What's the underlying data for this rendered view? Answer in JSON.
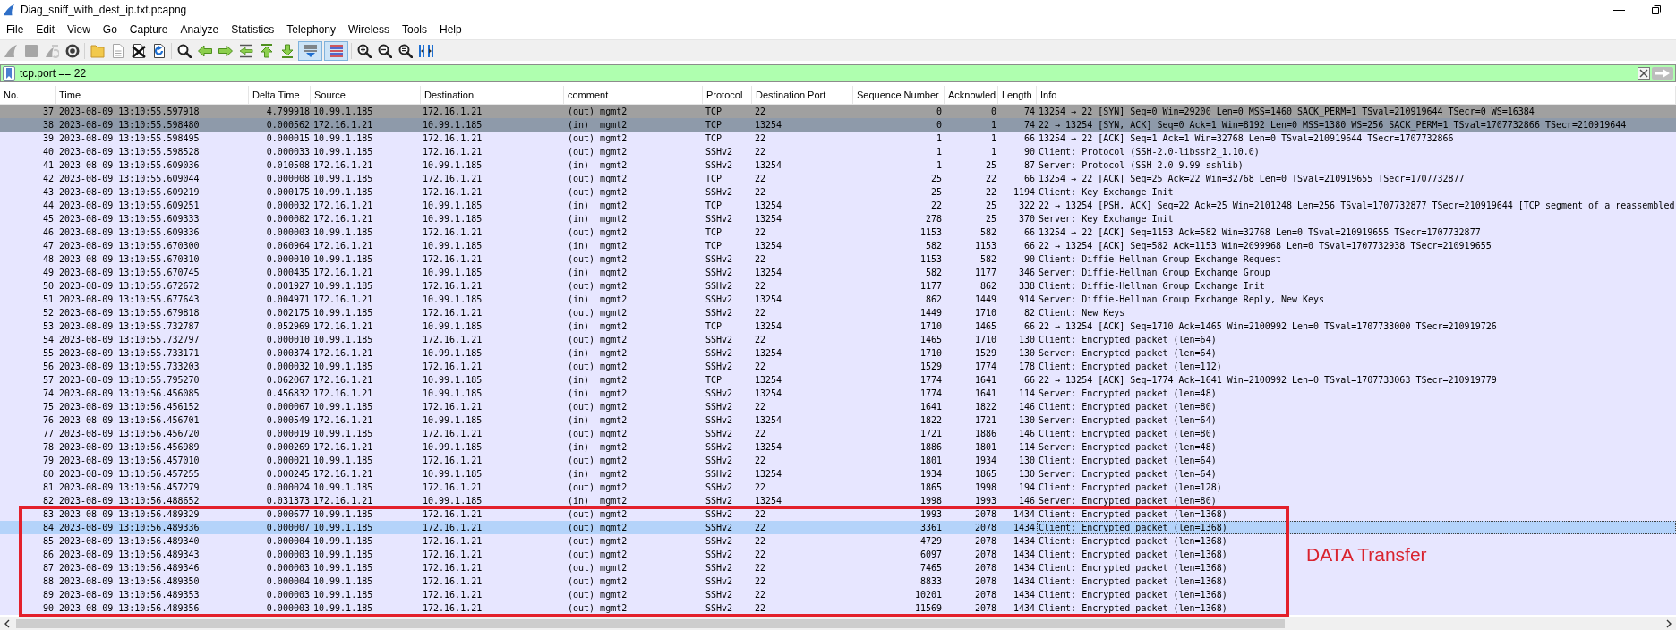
{
  "window": {
    "title": "Diag_sniff_with_dest_ip.txt.pcapng"
  },
  "menu": [
    "File",
    "Edit",
    "View",
    "Go",
    "Capture",
    "Analyze",
    "Statistics",
    "Telephony",
    "Wireless",
    "Tools",
    "Help"
  ],
  "toolbar": {
    "groups": [
      [
        {
          "kind": "start",
          "disabled": true,
          "pressed": false
        },
        {
          "kind": "stop",
          "disabled": true,
          "pressed": false
        },
        {
          "kind": "restart",
          "disabled": true,
          "pressed": false
        },
        {
          "kind": "options",
          "disabled": false,
          "pressed": false
        }
      ],
      [
        {
          "kind": "open",
          "disabled": false,
          "pressed": false
        },
        {
          "kind": "save",
          "disabled": true,
          "pressed": false
        },
        {
          "kind": "close",
          "disabled": false,
          "pressed": false
        },
        {
          "kind": "reload",
          "disabled": false,
          "pressed": false
        }
      ],
      [
        {
          "kind": "find",
          "disabled": false,
          "pressed": false
        },
        {
          "kind": "back",
          "disabled": false,
          "pressed": false
        },
        {
          "kind": "forward",
          "disabled": false,
          "pressed": false
        },
        {
          "kind": "goto",
          "disabled": false,
          "pressed": false
        },
        {
          "kind": "first",
          "disabled": false,
          "pressed": false
        },
        {
          "kind": "last",
          "disabled": false,
          "pressed": false
        },
        {
          "kind": "autoscroll",
          "disabled": false,
          "pressed": true
        },
        {
          "kind": "colorize",
          "disabled": false,
          "pressed": true
        }
      ],
      [
        {
          "kind": "zoomin",
          "disabled": false,
          "pressed": false
        },
        {
          "kind": "zoomout",
          "disabled": false,
          "pressed": false
        },
        {
          "kind": "zoomreset",
          "disabled": false,
          "pressed": false
        },
        {
          "kind": "resize",
          "disabled": false,
          "pressed": false
        }
      ]
    ]
  },
  "filter": {
    "value": "tcp.port == 22"
  },
  "packet_list": {
    "columns": [
      "No.",
      "Time",
      "Delta Time",
      "Source",
      "Destination",
      "comment",
      "Protocol",
      "Destination Port",
      "Sequence Number",
      "Acknowled",
      "Length",
      "Info"
    ],
    "rows": [
      {
        "cells": [
          "37",
          "2023-08-09 13:10:55.597918",
          "4.799918",
          "10.99.1.185",
          "172.16.1.21",
          "(out) mgmt2",
          "TCP",
          "22",
          "0",
          "0",
          "74",
          "13254 → 22 [SYN] Seq=0 Win=29200 Len=0 MSS=1460 SACK_PERM=1 TSval=210919644 TSecr=0 WS=16384"
        ],
        "color": "#a0a0a0",
        "selected": false
      },
      {
        "cells": [
          "38",
          "2023-08-09 13:10:55.598480",
          "0.000562",
          "172.16.1.21",
          "10.99.1.185",
          "(in)  mgmt2",
          "TCP",
          "13254",
          "0",
          "1",
          "74",
          "22 → 13254 [SYN, ACK] Seq=0 Ack=1 Win=8192 Len=0 MSS=1380 WS=256 SACK_PERM=1 TSval=1707732866 TSecr=210919644"
        ],
        "color": "#8e9aaa",
        "selected": false
      },
      {
        "cells": [
          "39",
          "2023-08-09 13:10:55.598495",
          "0.000015",
          "10.99.1.185",
          "172.16.1.21",
          "(out) mgmt2",
          "TCP",
          "22",
          "1",
          "1",
          "66",
          "13254 → 22 [ACK] Seq=1 Ack=1 Win=32768 Len=0 TSval=210919644 TSecr=1707732866"
        ],
        "color": "#e7e6ff",
        "selected": false
      },
      {
        "cells": [
          "40",
          "2023-08-09 13:10:55.598528",
          "0.000033",
          "10.99.1.185",
          "172.16.1.21",
          "(out) mgmt2",
          "SSHv2",
          "22",
          "1",
          "1",
          "90",
          "Client: Protocol (SSH-2.0-libssh2_1.10.0)"
        ],
        "color": "#e7e6ff",
        "selected": false
      },
      {
        "cells": [
          "41",
          "2023-08-09 13:10:55.609036",
          "0.010508",
          "172.16.1.21",
          "10.99.1.185",
          "(in)  mgmt2",
          "SSHv2",
          "13254",
          "1",
          "25",
          "87",
          "Server: Protocol (SSH-2.0-9.99 sshlib)"
        ],
        "color": "#e7e6ff",
        "selected": false
      },
      {
        "cells": [
          "42",
          "2023-08-09 13:10:55.609044",
          "0.000008",
          "10.99.1.185",
          "172.16.1.21",
          "(out) mgmt2",
          "TCP",
          "22",
          "25",
          "22",
          "66",
          "13254 → 22 [ACK] Seq=25 Ack=22 Win=32768 Len=0 TSval=210919655 TSecr=1707732877"
        ],
        "color": "#e7e6ff",
        "selected": false
      },
      {
        "cells": [
          "43",
          "2023-08-09 13:10:55.609219",
          "0.000175",
          "10.99.1.185",
          "172.16.1.21",
          "(out) mgmt2",
          "SSHv2",
          "22",
          "25",
          "22",
          "1194",
          "Client: Key Exchange Init"
        ],
        "color": "#e7e6ff",
        "selected": false
      },
      {
        "cells": [
          "44",
          "2023-08-09 13:10:55.609251",
          "0.000032",
          "172.16.1.21",
          "10.99.1.185",
          "(in)  mgmt2",
          "TCP",
          "13254",
          "22",
          "25",
          "322",
          "22 → 13254 [PSH, ACK] Seq=22 Ack=25 Win=2101248 Len=256 TSval=1707732877 TSecr=210919644 [TCP segment of a reassembled"
        ],
        "color": "#e7e6ff",
        "selected": false
      },
      {
        "cells": [
          "45",
          "2023-08-09 13:10:55.609333",
          "0.000082",
          "172.16.1.21",
          "10.99.1.185",
          "(in)  mgmt2",
          "SSHv2",
          "13254",
          "278",
          "25",
          "370",
          "Server: Key Exchange Init"
        ],
        "color": "#e7e6ff",
        "selected": false
      },
      {
        "cells": [
          "46",
          "2023-08-09 13:10:55.609336",
          "0.000003",
          "10.99.1.185",
          "172.16.1.21",
          "(out) mgmt2",
          "TCP",
          "22",
          "1153",
          "582",
          "66",
          "13254 → 22 [ACK] Seq=1153 Ack=582 Win=32768 Len=0 TSval=210919655 TSecr=1707732877"
        ],
        "color": "#e7e6ff",
        "selected": false
      },
      {
        "cells": [
          "47",
          "2023-08-09 13:10:55.670300",
          "0.060964",
          "172.16.1.21",
          "10.99.1.185",
          "(in)  mgmt2",
          "TCP",
          "13254",
          "582",
          "1153",
          "66",
          "22 → 13254 [ACK] Seq=582 Ack=1153 Win=2099968 Len=0 TSval=1707732938 TSecr=210919655"
        ],
        "color": "#e7e6ff",
        "selected": false
      },
      {
        "cells": [
          "48",
          "2023-08-09 13:10:55.670310",
          "0.000010",
          "10.99.1.185",
          "172.16.1.21",
          "(out) mgmt2",
          "SSHv2",
          "22",
          "1153",
          "582",
          "90",
          "Client: Diffie-Hellman Group Exchange Request"
        ],
        "color": "#e7e6ff",
        "selected": false
      },
      {
        "cells": [
          "49",
          "2023-08-09 13:10:55.670745",
          "0.000435",
          "172.16.1.21",
          "10.99.1.185",
          "(in)  mgmt2",
          "SSHv2",
          "13254",
          "582",
          "1177",
          "346",
          "Server: Diffie-Hellman Group Exchange Group"
        ],
        "color": "#e7e6ff",
        "selected": false
      },
      {
        "cells": [
          "50",
          "2023-08-09 13:10:55.672672",
          "0.001927",
          "10.99.1.185",
          "172.16.1.21",
          "(out) mgmt2",
          "SSHv2",
          "22",
          "1177",
          "862",
          "338",
          "Client: Diffie-Hellman Group Exchange Init"
        ],
        "color": "#e7e6ff",
        "selected": false
      },
      {
        "cells": [
          "51",
          "2023-08-09 13:10:55.677643",
          "0.004971",
          "172.16.1.21",
          "10.99.1.185",
          "(in)  mgmt2",
          "SSHv2",
          "13254",
          "862",
          "1449",
          "914",
          "Server: Diffie-Hellman Group Exchange Reply, New Keys"
        ],
        "color": "#e7e6ff",
        "selected": false
      },
      {
        "cells": [
          "52",
          "2023-08-09 13:10:55.679818",
          "0.002175",
          "10.99.1.185",
          "172.16.1.21",
          "(out) mgmt2",
          "SSHv2",
          "22",
          "1449",
          "1710",
          "82",
          "Client: New Keys"
        ],
        "color": "#e7e6ff",
        "selected": false
      },
      {
        "cells": [
          "53",
          "2023-08-09 13:10:55.732787",
          "0.052969",
          "172.16.1.21",
          "10.99.1.185",
          "(in)  mgmt2",
          "TCP",
          "13254",
          "1710",
          "1465",
          "66",
          "22 → 13254 [ACK] Seq=1710 Ack=1465 Win=2100992 Len=0 TSval=1707733000 TSecr=210919726"
        ],
        "color": "#e7e6ff",
        "selected": false
      },
      {
        "cells": [
          "54",
          "2023-08-09 13:10:55.732797",
          "0.000010",
          "10.99.1.185",
          "172.16.1.21",
          "(out) mgmt2",
          "SSHv2",
          "22",
          "1465",
          "1710",
          "130",
          "Client: Encrypted packet (len=64)"
        ],
        "color": "#e7e6ff",
        "selected": false
      },
      {
        "cells": [
          "55",
          "2023-08-09 13:10:55.733171",
          "0.000374",
          "172.16.1.21",
          "10.99.1.185",
          "(in)  mgmt2",
          "SSHv2",
          "13254",
          "1710",
          "1529",
          "130",
          "Server: Encrypted packet (len=64)"
        ],
        "color": "#e7e6ff",
        "selected": false
      },
      {
        "cells": [
          "56",
          "2023-08-09 13:10:55.733203",
          "0.000032",
          "10.99.1.185",
          "172.16.1.21",
          "(out) mgmt2",
          "SSHv2",
          "22",
          "1529",
          "1774",
          "178",
          "Client: Encrypted packet (len=112)"
        ],
        "color": "#e7e6ff",
        "selected": false
      },
      {
        "cells": [
          "57",
          "2023-08-09 13:10:55.795270",
          "0.062067",
          "172.16.1.21",
          "10.99.1.185",
          "(in)  mgmt2",
          "TCP",
          "13254",
          "1774",
          "1641",
          "66",
          "22 → 13254 [ACK] Seq=1774 Ack=1641 Win=2100992 Len=0 TSval=1707733063 TSecr=210919779"
        ],
        "color": "#e7e6ff",
        "selected": false
      },
      {
        "cells": [
          "74",
          "2023-08-09 13:10:56.456085",
          "0.456832",
          "172.16.1.21",
          "10.99.1.185",
          "(in)  mgmt2",
          "SSHv2",
          "13254",
          "1774",
          "1641",
          "114",
          "Server: Encrypted packet (len=48)"
        ],
        "color": "#e7e6ff",
        "selected": false
      },
      {
        "cells": [
          "75",
          "2023-08-09 13:10:56.456152",
          "0.000067",
          "10.99.1.185",
          "172.16.1.21",
          "(out) mgmt2",
          "SSHv2",
          "22",
          "1641",
          "1822",
          "146",
          "Client: Encrypted packet (len=80)"
        ],
        "color": "#e7e6ff",
        "selected": false
      },
      {
        "cells": [
          "76",
          "2023-08-09 13:10:56.456701",
          "0.000549",
          "172.16.1.21",
          "10.99.1.185",
          "(in)  mgmt2",
          "SSHv2",
          "13254",
          "1822",
          "1721",
          "130",
          "Server: Encrypted packet (len=64)"
        ],
        "color": "#e7e6ff",
        "selected": false
      },
      {
        "cells": [
          "77",
          "2023-08-09 13:10:56.456720",
          "0.000019",
          "10.99.1.185",
          "172.16.1.21",
          "(out) mgmt2",
          "SSHv2",
          "22",
          "1721",
          "1886",
          "146",
          "Client: Encrypted packet (len=80)"
        ],
        "color": "#e7e6ff",
        "selected": false
      },
      {
        "cells": [
          "78",
          "2023-08-09 13:10:56.456989",
          "0.000269",
          "172.16.1.21",
          "10.99.1.185",
          "(in)  mgmt2",
          "SSHv2",
          "13254",
          "1886",
          "1801",
          "114",
          "Server: Encrypted packet (len=48)"
        ],
        "color": "#e7e6ff",
        "selected": false
      },
      {
        "cells": [
          "79",
          "2023-08-09 13:10:56.457010",
          "0.000021",
          "10.99.1.185",
          "172.16.1.21",
          "(out) mgmt2",
          "SSHv2",
          "22",
          "1801",
          "1934",
          "130",
          "Client: Encrypted packet (len=64)"
        ],
        "color": "#e7e6ff",
        "selected": false
      },
      {
        "cells": [
          "80",
          "2023-08-09 13:10:56.457255",
          "0.000245",
          "172.16.1.21",
          "10.99.1.185",
          "(in)  mgmt2",
          "SSHv2",
          "13254",
          "1934",
          "1865",
          "130",
          "Server: Encrypted packet (len=64)"
        ],
        "color": "#e7e6ff",
        "selected": false
      },
      {
        "cells": [
          "81",
          "2023-08-09 13:10:56.457279",
          "0.000024",
          "10.99.1.185",
          "172.16.1.21",
          "(out) mgmt2",
          "SSHv2",
          "22",
          "1865",
          "1998",
          "194",
          "Client: Encrypted packet (len=128)"
        ],
        "color": "#e7e6ff",
        "selected": false
      },
      {
        "cells": [
          "82",
          "2023-08-09 13:10:56.488652",
          "0.031373",
          "172.16.1.21",
          "10.99.1.185",
          "(in)  mgmt2",
          "SSHv2",
          "13254",
          "1998",
          "1993",
          "146",
          "Server: Encrypted packet (len=80)"
        ],
        "color": "#e7e6ff",
        "selected": false
      }
    ],
    "annotation": {
      "label": "DATA Transfer",
      "rows": [
        {
          "cells": [
            "83",
            "2023-08-09 13:10:56.489329",
            "0.000677",
            "10.99.1.185",
            "172.16.1.21",
            "(out) mgmt2",
            "SSHv2",
            "22",
            "1993",
            "2078",
            "1434",
            "Client: Encrypted packet (len=1368)"
          ],
          "color": "#e7e6ff",
          "selected": false
        },
        {
          "cells": [
            "84",
            "2023-08-09 13:10:56.489336",
            "0.000007",
            "10.99.1.185",
            "172.16.1.21",
            "(out) mgmt2",
            "SSHv2",
            "22",
            "3361",
            "2078",
            "1434",
            "Client: Encrypted packet (len=1368)"
          ],
          "selected": true
        },
        {
          "cells": [
            "85",
            "2023-08-09 13:10:56.489340",
            "0.000004",
            "10.99.1.185",
            "172.16.1.21",
            "(out) mgmt2",
            "SSHv2",
            "22",
            "4729",
            "2078",
            "1434",
            "Client: Encrypted packet (len=1368)"
          ],
          "color": "#e7e6ff",
          "selected": false
        },
        {
          "cells": [
            "86",
            "2023-08-09 13:10:56.489343",
            "0.000003",
            "10.99.1.185",
            "172.16.1.21",
            "(out) mgmt2",
            "SSHv2",
            "22",
            "6097",
            "2078",
            "1434",
            "Client: Encrypted packet (len=1368)"
          ],
          "color": "#e7e6ff",
          "selected": false
        },
        {
          "cells": [
            "87",
            "2023-08-09 13:10:56.489346",
            "0.000003",
            "10.99.1.185",
            "172.16.1.21",
            "(out) mgmt2",
            "SSHv2",
            "22",
            "7465",
            "2078",
            "1434",
            "Client: Encrypted packet (len=1368)"
          ],
          "color": "#e7e6ff",
          "selected": false
        },
        {
          "cells": [
            "88",
            "2023-08-09 13:10:56.489350",
            "0.000004",
            "10.99.1.185",
            "172.16.1.21",
            "(out) mgmt2",
            "SSHv2",
            "22",
            "8833",
            "2078",
            "1434",
            "Client: Encrypted packet (len=1368)"
          ],
          "color": "#e7e6ff",
          "selected": false
        },
        {
          "cells": [
            "89",
            "2023-08-09 13:10:56.489353",
            "0.000003",
            "10.99.1.185",
            "172.16.1.21",
            "(out) mgmt2",
            "SSHv2",
            "22",
            "10201",
            "2078",
            "1434",
            "Client: Encrypted packet (len=1368)"
          ],
          "color": "#e7e6ff",
          "selected": false
        },
        {
          "cells": [
            "90",
            "2023-08-09 13:10:56.489356",
            "0.000003",
            "10.99.1.185",
            "172.16.1.21",
            "(out) mgmt2",
            "SSHv2",
            "22",
            "11569",
            "2078",
            "1434",
            "Client: Encrypted packet (len=1368)"
          ],
          "color": "#e7e6ff",
          "selected": false
        }
      ]
    }
  }
}
